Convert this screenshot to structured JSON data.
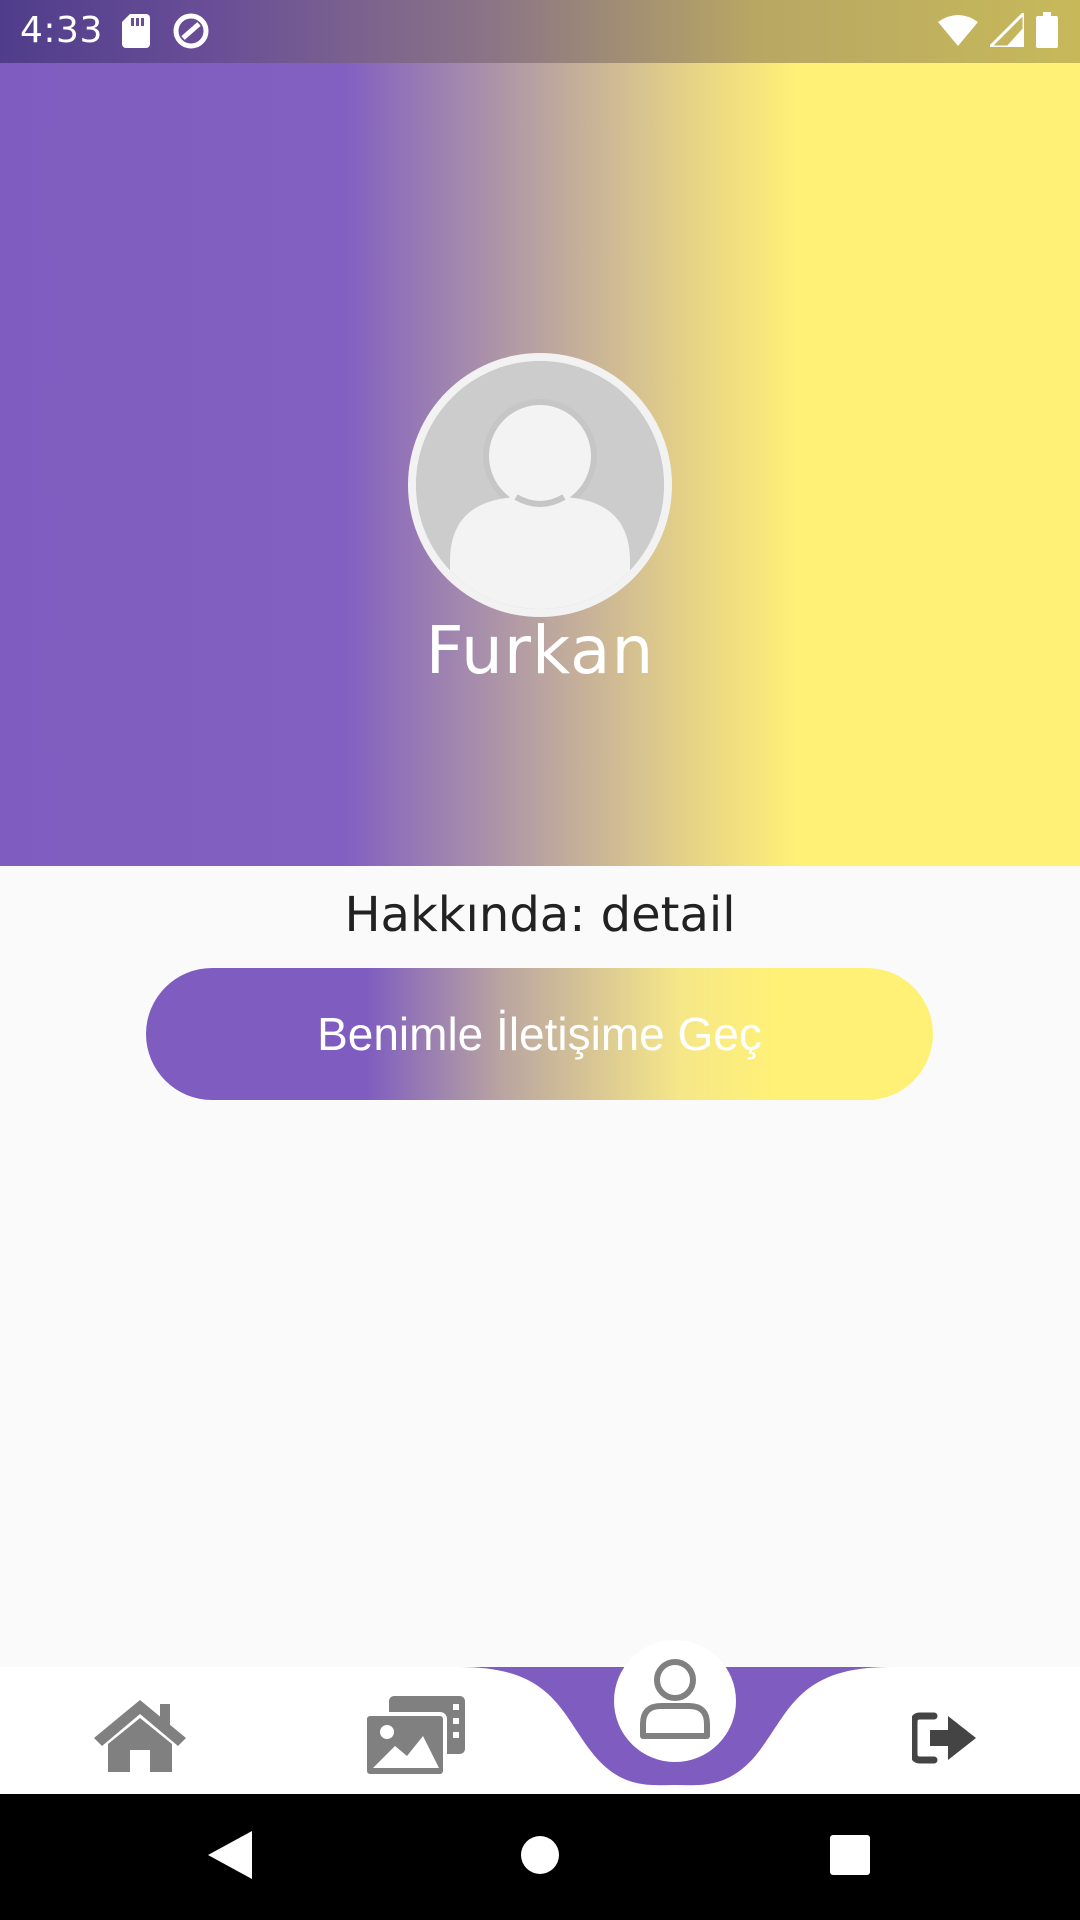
{
  "status_bar": {
    "time": "4:33",
    "left_icons": [
      "sd-card-icon",
      "data-saver-icon"
    ],
    "right_icons": [
      "wifi-icon",
      "signal-icon",
      "battery-icon"
    ]
  },
  "profile": {
    "name": "Furkan",
    "avatar": "default-avatar-icon"
  },
  "about": {
    "text": "Hakkında: detail"
  },
  "contact_button": {
    "label": "Benimle İletişime Geç"
  },
  "bottom_nav": {
    "items": [
      {
        "icon": "home-icon",
        "active": false
      },
      {
        "icon": "gallery-icon",
        "active": false
      },
      {
        "icon": "profile-icon",
        "active": true
      },
      {
        "icon": "logout-icon",
        "active": false
      }
    ]
  },
  "colors": {
    "purple": "#7F5DC0",
    "yellow": "#FFF176",
    "nav_icon": "#808080",
    "background": "#FAFAFA"
  },
  "system_nav": {
    "buttons": [
      "back-icon",
      "home-circle-icon",
      "recents-icon"
    ]
  }
}
